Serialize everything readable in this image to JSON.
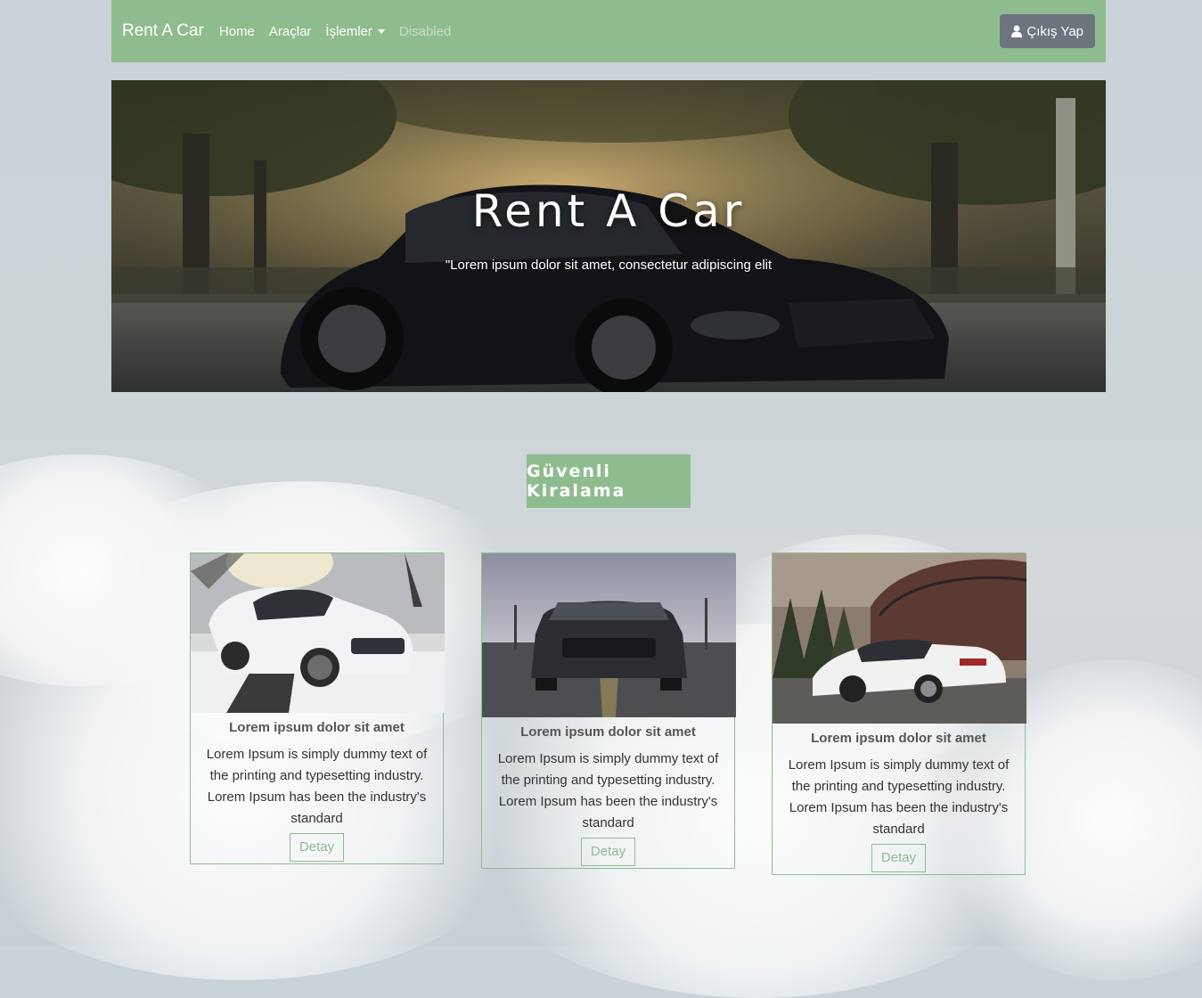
{
  "navbar": {
    "brand": "Rent A Car",
    "links": [
      {
        "label": "Home"
      },
      {
        "label": "Araçlar"
      },
      {
        "label": "İşlemler"
      },
      {
        "label": "Disabled"
      }
    ],
    "logout_label": "Çıkış Yap",
    "color": "#8fbc8f"
  },
  "hero": {
    "title": "Rent A Car",
    "subtitle": "\"Lorem ipsum dolor sit amet, consectetur adipiscing elit"
  },
  "section": {
    "badge": "Güvenli Kiralama"
  },
  "cards": [
    {
      "title": "Lorem ipsum dolor sit amet",
      "text": "Lorem Ipsum is simply dummy text of the printing and typesetting industry. Lorem Ipsum has been the industry's standard",
      "button": "Detay"
    },
    {
      "title": "Lorem ipsum dolor sit amet",
      "text": "Lorem Ipsum is simply dummy text of the printing and typesetting industry. Lorem Ipsum has been the industry's standard",
      "button": "Detay"
    },
    {
      "title": "Lorem ipsum dolor sit amet",
      "text": "Lorem Ipsum is simply dummy text of the printing and typesetting industry. Lorem Ipsum has been the industry's standard",
      "button": "Detay"
    }
  ]
}
